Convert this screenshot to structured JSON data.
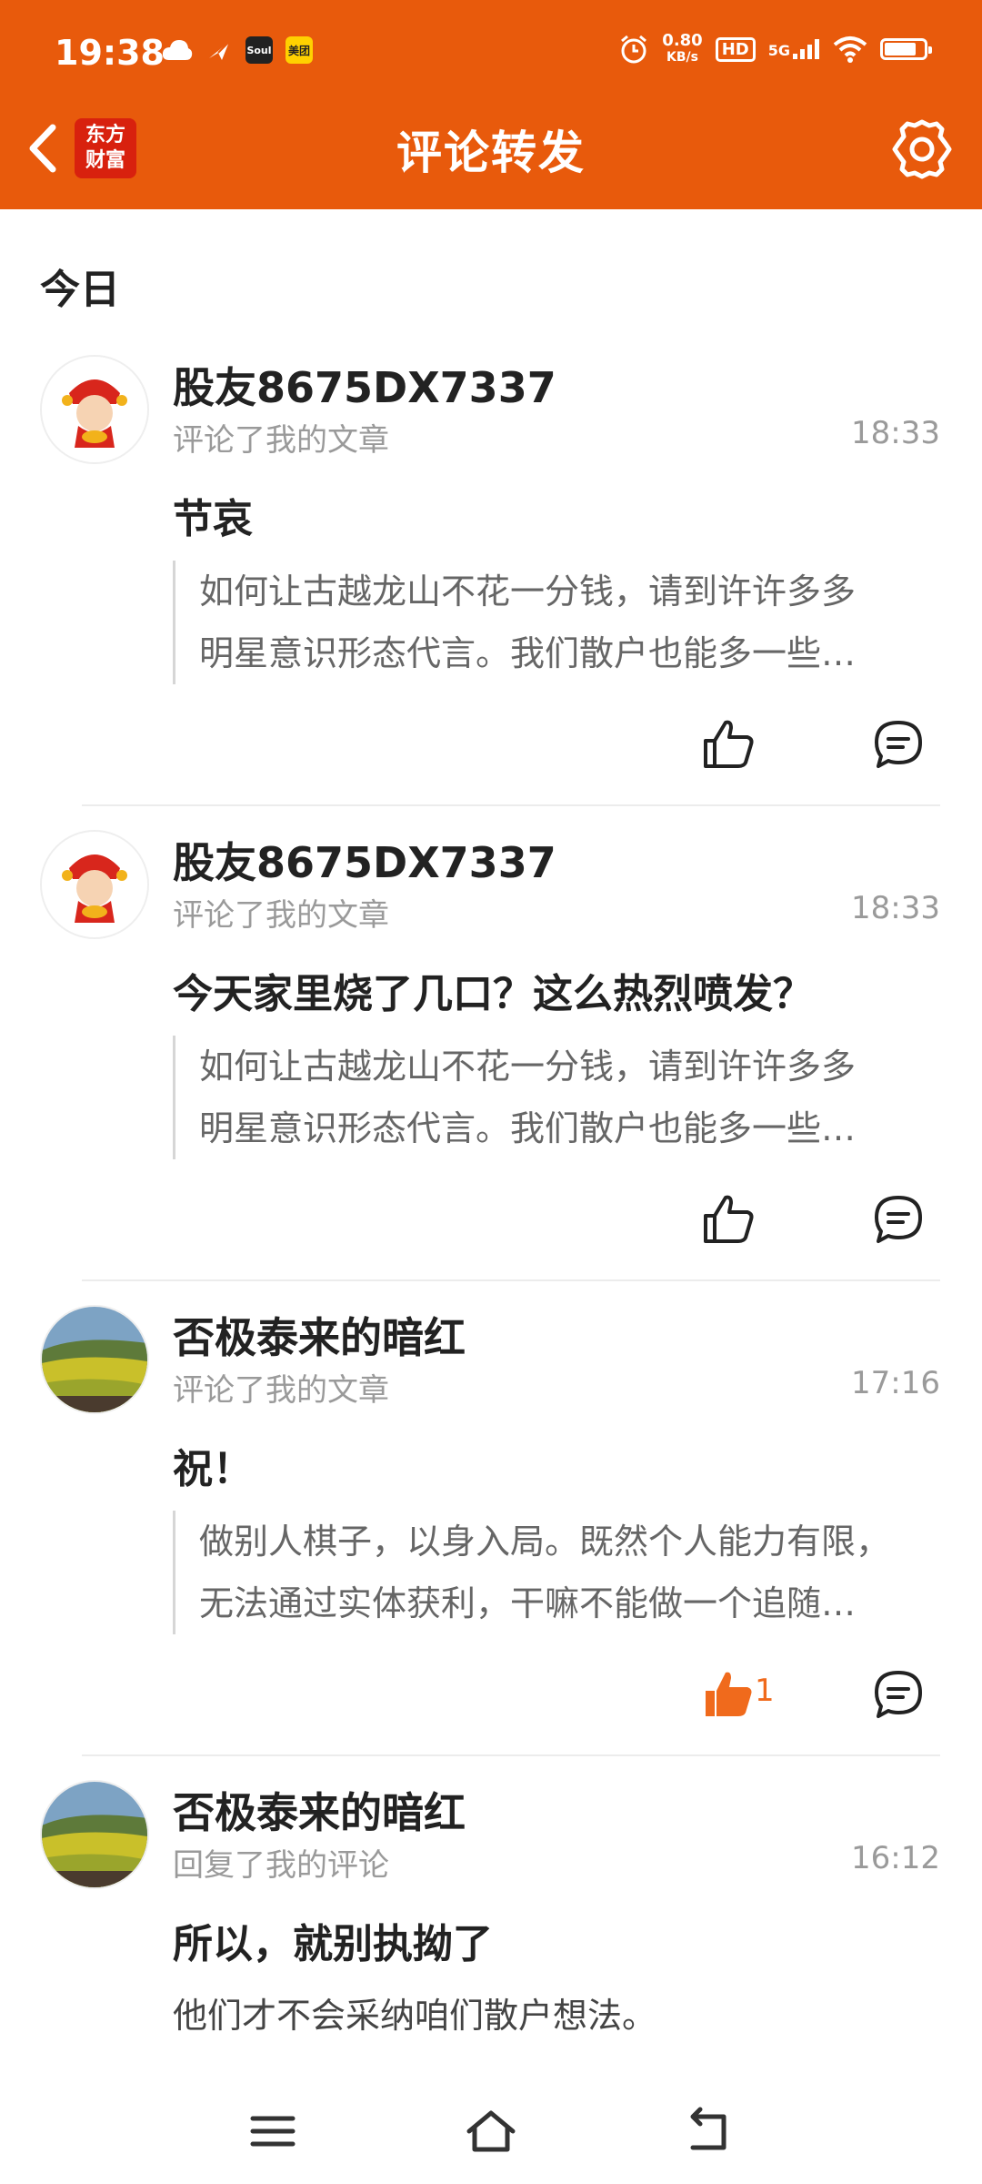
{
  "status_bar": {
    "time": "19:38",
    "apps": [
      "cloud-icon",
      "message-app-icon",
      "soul-app-icon",
      "meituan-app-icon"
    ],
    "soul_label": "Soul",
    "meituan_label": "美团",
    "speed_value": "0.80",
    "speed_unit": "KB/s",
    "hd_label": "HD",
    "network_label": "5G",
    "battery_level": 0.8
  },
  "header": {
    "logo_line1": "东方",
    "logo_line2": "财富",
    "title": "评论转发",
    "accent_color": "#E85A0C"
  },
  "section_title": "今日",
  "items": [
    {
      "name": "股友8675DX7337",
      "action": "评论了我的文章",
      "time": "18:33",
      "comment": "节哀",
      "quote_line1": "如何让古越龙山不花一分钱，请到许许多多",
      "quote_line2": "明星意识形态代言。我们散户也能多一些…",
      "liked": false,
      "like_count": ""
    },
    {
      "name": "股友8675DX7337",
      "action": "评论了我的文章",
      "time": "18:33",
      "comment": "今天家里烧了几口？这么热烈喷发？",
      "quote_line1": "如何让古越龙山不花一分钱，请到许许多多",
      "quote_line2": "明星意识形态代言。我们散户也能多一些…",
      "liked": false,
      "like_count": ""
    },
    {
      "name": "否极泰来的暗红",
      "action": "评论了我的文章",
      "time": "17:16",
      "comment": "祝！",
      "quote_line1": "做别人棋子，以身入局。既然个人能力有限，",
      "quote_line2": "无法通过实体获利，干嘛不能做一个追随…",
      "liked": true,
      "like_count": "1"
    },
    {
      "name": "否极泰来的暗红",
      "action": "回复了我的评论",
      "time": "16:12",
      "comment": "所以，就别执拗了",
      "reply": "他们才不会采纳咱们散户想法。"
    }
  ],
  "bottom_nav": [
    "menu-icon",
    "home-icon",
    "back-icon"
  ]
}
